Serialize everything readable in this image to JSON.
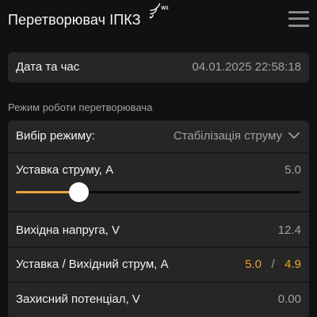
{
  "header": {
    "title": "Перетворювач ІПКЗ",
    "signal_icon": "wifi-signal-icon",
    "signal_tag": "W3",
    "menu_icon": "hamburger-menu-icon"
  },
  "datetime": {
    "label": "Дата та час",
    "value": "04.01.2025 22:58:18"
  },
  "section": {
    "title": "Режим роботи перетворювача"
  },
  "mode": {
    "label": "Вибір режиму:",
    "selected": "Стабілізація струму",
    "dropdown_icon": "chevron-down-icon"
  },
  "current_setpoint": {
    "label": "Уставка струму, А",
    "value": "5.0",
    "slider_fraction": 0.22
  },
  "output_voltage": {
    "label": "Вихідна напруга, V",
    "value": "12.4"
  },
  "setpoint_output": {
    "label": "Уставка / Вихідний струм, А",
    "setpoint": "5.0",
    "separator": "/",
    "output": "4.9"
  },
  "protective_potential": {
    "label": "Захисний потенціал, V",
    "value": "0.00"
  },
  "colors": {
    "background": "#111111",
    "card": "#262626",
    "accent": "#f0a32a",
    "muted_text": "#a0a0a0"
  }
}
